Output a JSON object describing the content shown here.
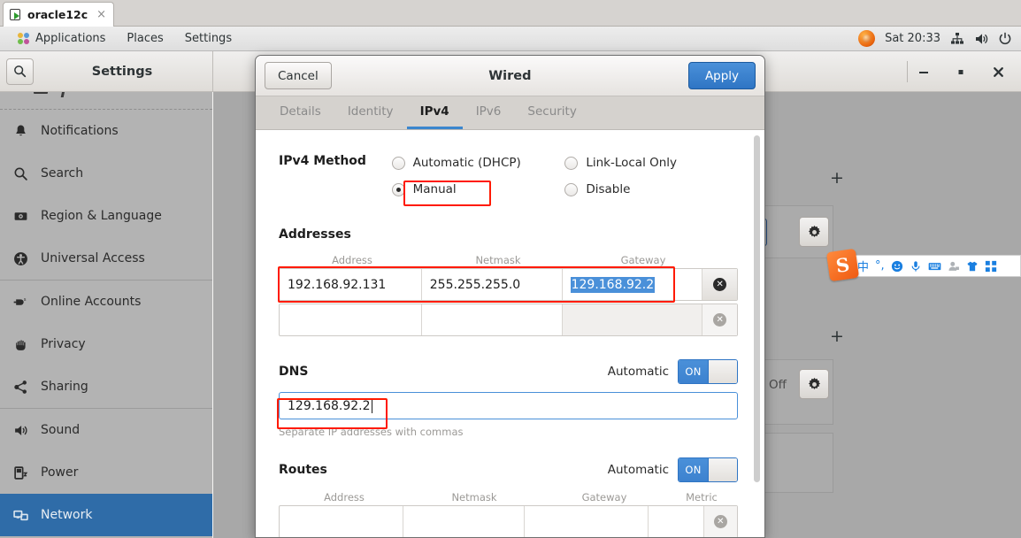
{
  "vm_tab": {
    "label": "oracle12c",
    "close": "×",
    "icon": "vm-play-icon"
  },
  "panel": {
    "menus": [
      {
        "label": "Applications",
        "icon": "applications-icon"
      },
      {
        "label": "Places",
        "icon": ""
      },
      {
        "label": "Settings",
        "icon": ""
      }
    ],
    "clock": "Sat 20:33",
    "tray": [
      "firefox-icon",
      "network-icon",
      "volume-icon",
      "power-icon"
    ]
  },
  "settings_window": {
    "title": "Settings",
    "search_icon": "search-icon",
    "window_controls": {
      "minimize": "–",
      "maximize": "□",
      "close": "✕"
    },
    "sidebar_items": [
      {
        "label": "Notifications",
        "icon": "bell-icon",
        "active": false
      },
      {
        "label": "Search",
        "icon": "search-icon",
        "active": false
      },
      {
        "label": "Region & Language",
        "icon": "flag-icon",
        "active": false
      },
      {
        "label": "Universal Access",
        "icon": "accessibility-icon",
        "active": false
      },
      {
        "label": "Online Accounts",
        "icon": "plug-icon",
        "active": false
      },
      {
        "label": "Privacy",
        "icon": "hand-icon",
        "active": false
      },
      {
        "label": "Sharing",
        "icon": "share-icon",
        "active": false
      },
      {
        "label": "Sound",
        "icon": "speaker-icon",
        "active": false
      },
      {
        "label": "Power",
        "icon": "battery-icon",
        "active": false
      },
      {
        "label": "Network",
        "icon": "network-icon",
        "active": true
      }
    ],
    "background_panel": {
      "add_marks": [
        "+",
        "+"
      ],
      "off_label": "Off",
      "gear_icon": "gear-icon"
    }
  },
  "sogou_toolbar": {
    "logo": "S",
    "items": [
      {
        "icon": "chinese-mode-icon",
        "glyph": "中"
      },
      {
        "icon": "punctuation-icon",
        "glyph": "°,"
      },
      {
        "icon": "emoji-icon",
        "glyph": "☺"
      },
      {
        "icon": "microphone-icon",
        "glyph": "⬤"
      },
      {
        "icon": "keyboard-icon",
        "glyph": "⌨"
      },
      {
        "icon": "user-icon",
        "glyph": "●"
      },
      {
        "icon": "skin-icon",
        "glyph": "▼"
      },
      {
        "icon": "apps-grid-icon",
        "glyph": "▒"
      }
    ]
  },
  "dialog": {
    "title": "Wired",
    "cancel_label": "Cancel",
    "apply_label": "Apply",
    "tabs": [
      {
        "label": "Details",
        "selected": false
      },
      {
        "label": "Identity",
        "selected": false
      },
      {
        "label": "IPv4",
        "selected": true
      },
      {
        "label": "IPv6",
        "selected": false
      },
      {
        "label": "Security",
        "selected": false
      }
    ],
    "ipv4_method": {
      "label": "IPv4 Method",
      "options": [
        {
          "label": "Automatic (DHCP)",
          "selected": false,
          "highlighted": false
        },
        {
          "label": "Manual",
          "selected": true,
          "highlighted": true
        },
        {
          "label": "Link-Local Only",
          "selected": false,
          "highlighted": false
        },
        {
          "label": "Disable",
          "selected": false,
          "highlighted": false
        }
      ]
    },
    "addresses": {
      "label": "Addresses",
      "columns": [
        "Address",
        "Netmask",
        "Gateway"
      ],
      "rows": [
        {
          "address": "192.168.92.131",
          "netmask": "255.255.255.0",
          "gateway": "129.168.92.2",
          "gateway_selected": true,
          "highlighted": true,
          "delete_enabled": true
        },
        {
          "address": "",
          "netmask": "",
          "gateway": "",
          "gateway_selected": false,
          "highlighted": false,
          "delete_enabled": false
        }
      ]
    },
    "dns": {
      "label": "DNS",
      "automatic_label": "Automatic",
      "toggle_state": "ON",
      "value": "129.168.92.2",
      "focused": true,
      "highlighted": true,
      "hint": "Separate IP addresses with commas"
    },
    "routes": {
      "label": "Routes",
      "automatic_label": "Automatic",
      "toggle_state": "ON",
      "columns": [
        "Address",
        "Netmask",
        "Gateway",
        "Metric"
      ],
      "rows": [
        {
          "address": "",
          "netmask": "",
          "gateway": "",
          "metric": ""
        }
      ]
    }
  },
  "colors": {
    "accent_blue": "#4a90d9",
    "selection_blue": "#2f6ca8",
    "highlight_red": "#ff1a00",
    "panel_gray": "#a8a8a8"
  }
}
